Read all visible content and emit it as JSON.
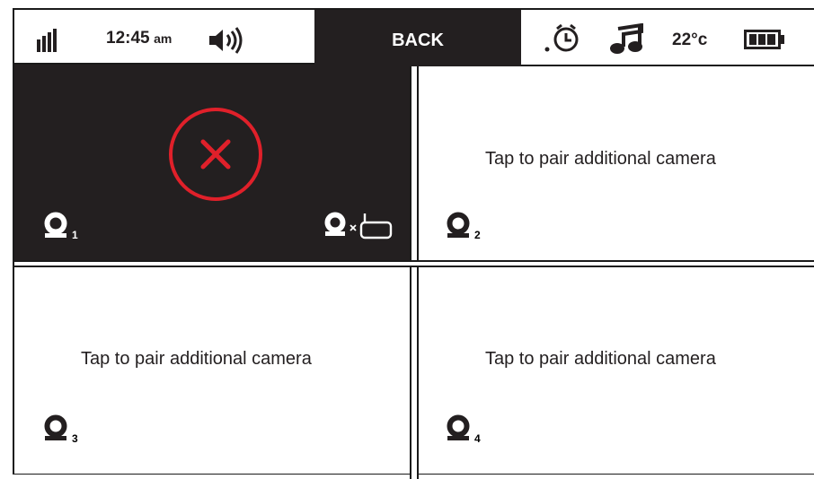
{
  "status": {
    "time": "12:45",
    "time_period": "am",
    "temperature": "22°c",
    "icons": [
      "signal-icon",
      "volume-icon",
      "alarm-clock-icon",
      "music-icon",
      "battery-icon"
    ]
  },
  "back_label": "BACK",
  "cameras": [
    {
      "number": "1",
      "state": "disconnected"
    },
    {
      "number": "2",
      "text": "Tap to pair additional camera"
    },
    {
      "number": "3",
      "text": "Tap to pair additional camera"
    },
    {
      "number": "4",
      "text": "Tap to pair additional camera"
    }
  ],
  "colors": {
    "dark": "#231f20",
    "error": "#e0202a",
    "background": "#ffffff"
  }
}
